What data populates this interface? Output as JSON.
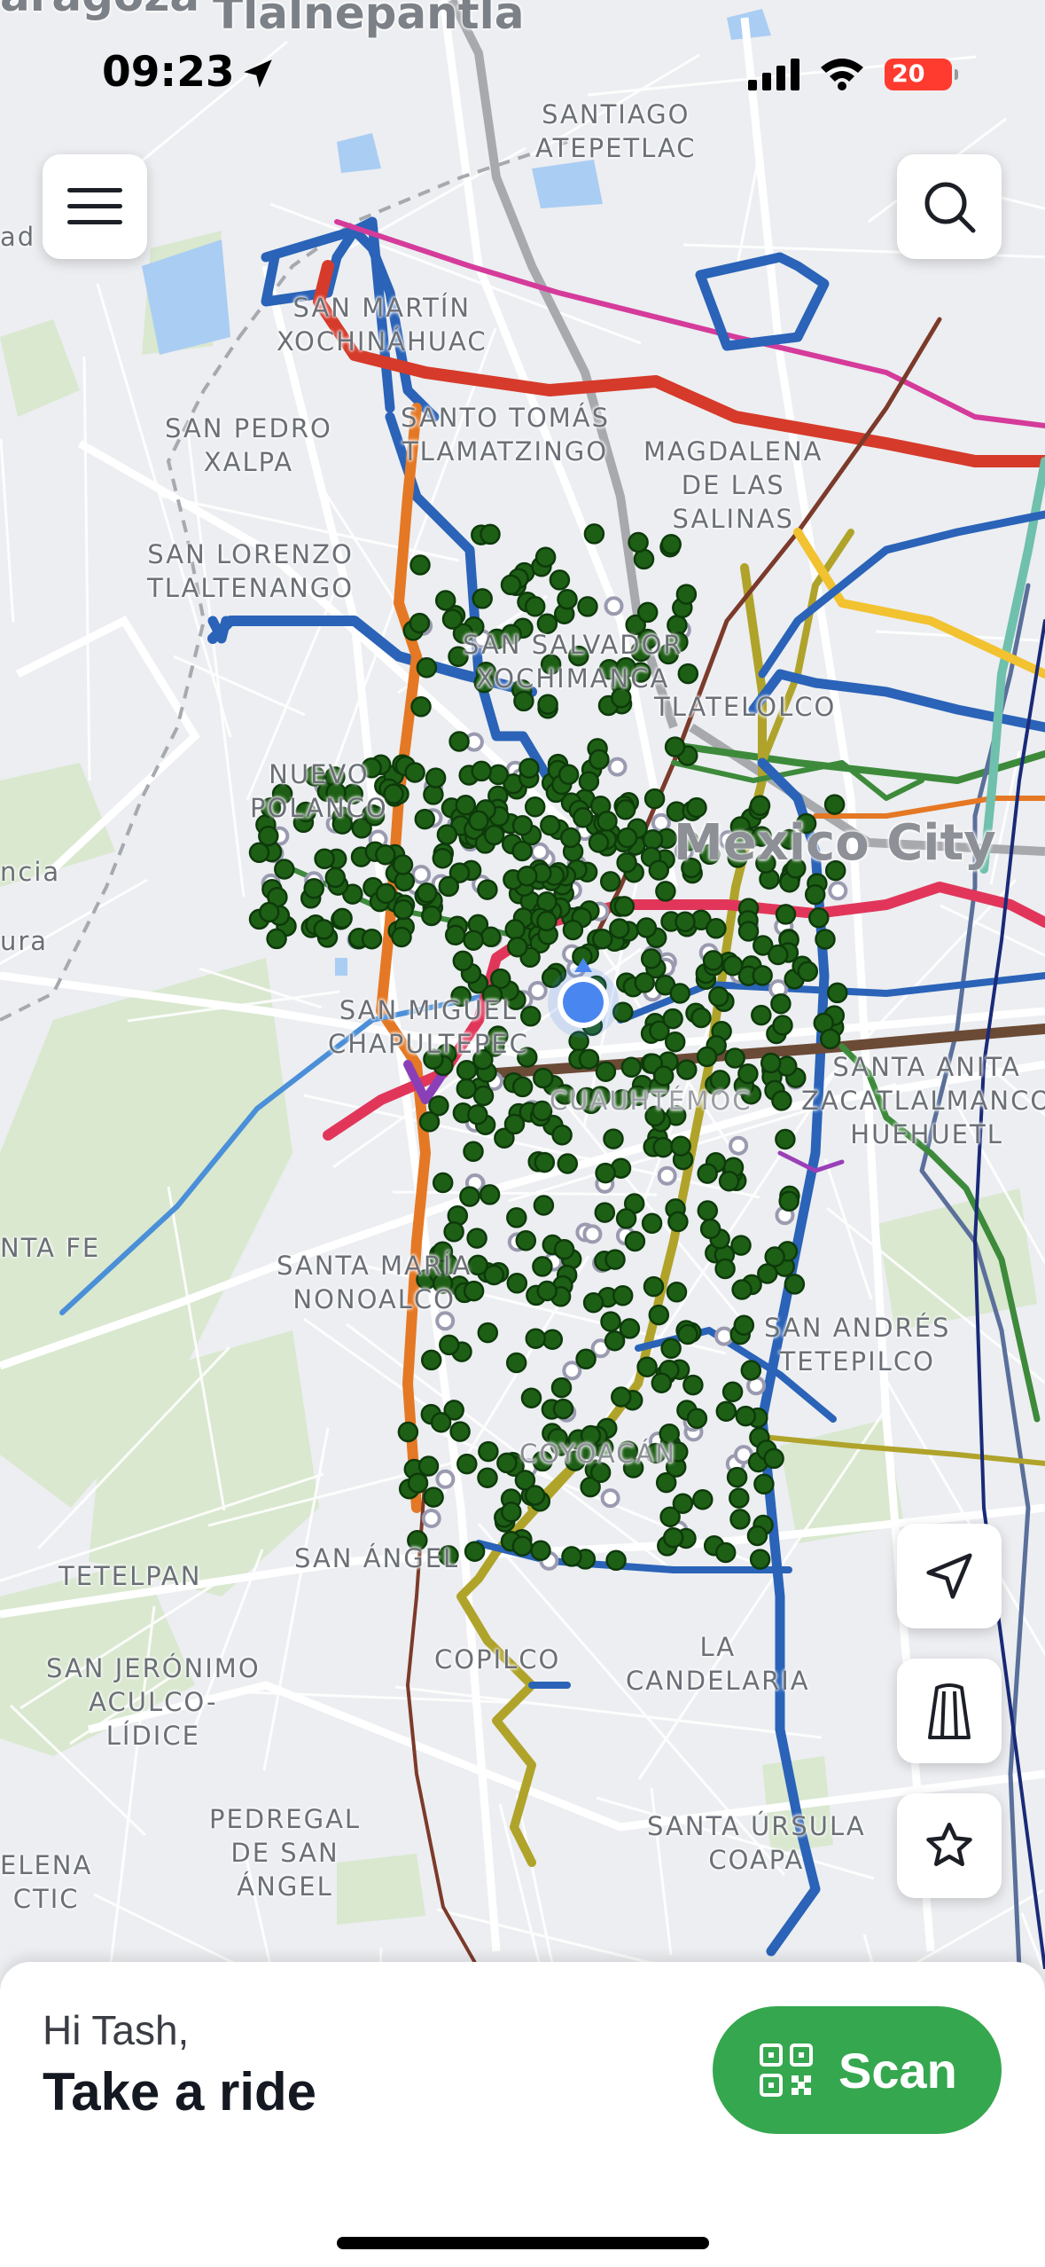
{
  "status_bar": {
    "time": "09:23",
    "battery": "20",
    "icons": [
      "location-arrow-icon",
      "cellular-signal-icon",
      "wifi-icon",
      "battery-icon"
    ]
  },
  "map": {
    "place_labels": [
      "Tlalnepantla",
      "SANTIAGO\nATEPETLAC",
      "SAN MARTÍN\nXOCHINÁHUAC",
      "SAN PEDRO\nXALPA",
      "SANTO TOMÁS\nTLAMATZINGO",
      "MAGDALENA\nDE LAS\nSALINAS",
      "SAN LORENZO\nTLALTENANGO",
      "SAN SALVADOR\nXOCHIMANCA",
      "TLATELOLCO",
      "NUEVO\nPOLANCO",
      "Mexico City",
      "SAN MIGUEL\nCHAPULTEPEC",
      "SANTA ANITA\nZACATLALMANCO\nHUEHUETL",
      "SANTA MARÍA\nNONOALCO",
      "SAN ANDRÉS\nTETEPILCO",
      "TETELPAN",
      "SAN ÁNGEL",
      "COPILCO",
      "LA\nCANDELARIA",
      "SAN JERÓNIMO\nACULCO-\nLÍDICE",
      "PEDREGAL\nDE SAN\nÁNGEL",
      "SANTA ÚRSULA\nCOAPA",
      "NTA FE",
      "ncia",
      "ura",
      "ad S",
      "aragoza",
      "ELENA\nCTIC",
      "CUAUHTÉMOC",
      "COYOACÁN"
    ],
    "colors": {
      "bike_station": "#1e5f16",
      "bike_station_outline": "#0d3a0a",
      "empty_station": "#9a9ab0",
      "user_location": "#4a86f0",
      "metro_line_1": "#e1365a",
      "metro_line_2": "#2a63b8",
      "metro_line_3": "#b0a32a",
      "metro_line_7": "#e57824",
      "metro_line_b": "#3d8a3b",
      "red_line": "#d63a2a"
    }
  },
  "buttons": {
    "menu": "menu-icon",
    "search": "search-icon",
    "recenter": "navigation-arrow-icon",
    "transit": "transit-icon",
    "favorites": "star-icon"
  },
  "sheet": {
    "greeting": "Hi Tash,",
    "headline": "Take a ride",
    "scan_label": "Scan",
    "scan_icon": "qr-code-icon",
    "brand_color": "#35a74f"
  }
}
